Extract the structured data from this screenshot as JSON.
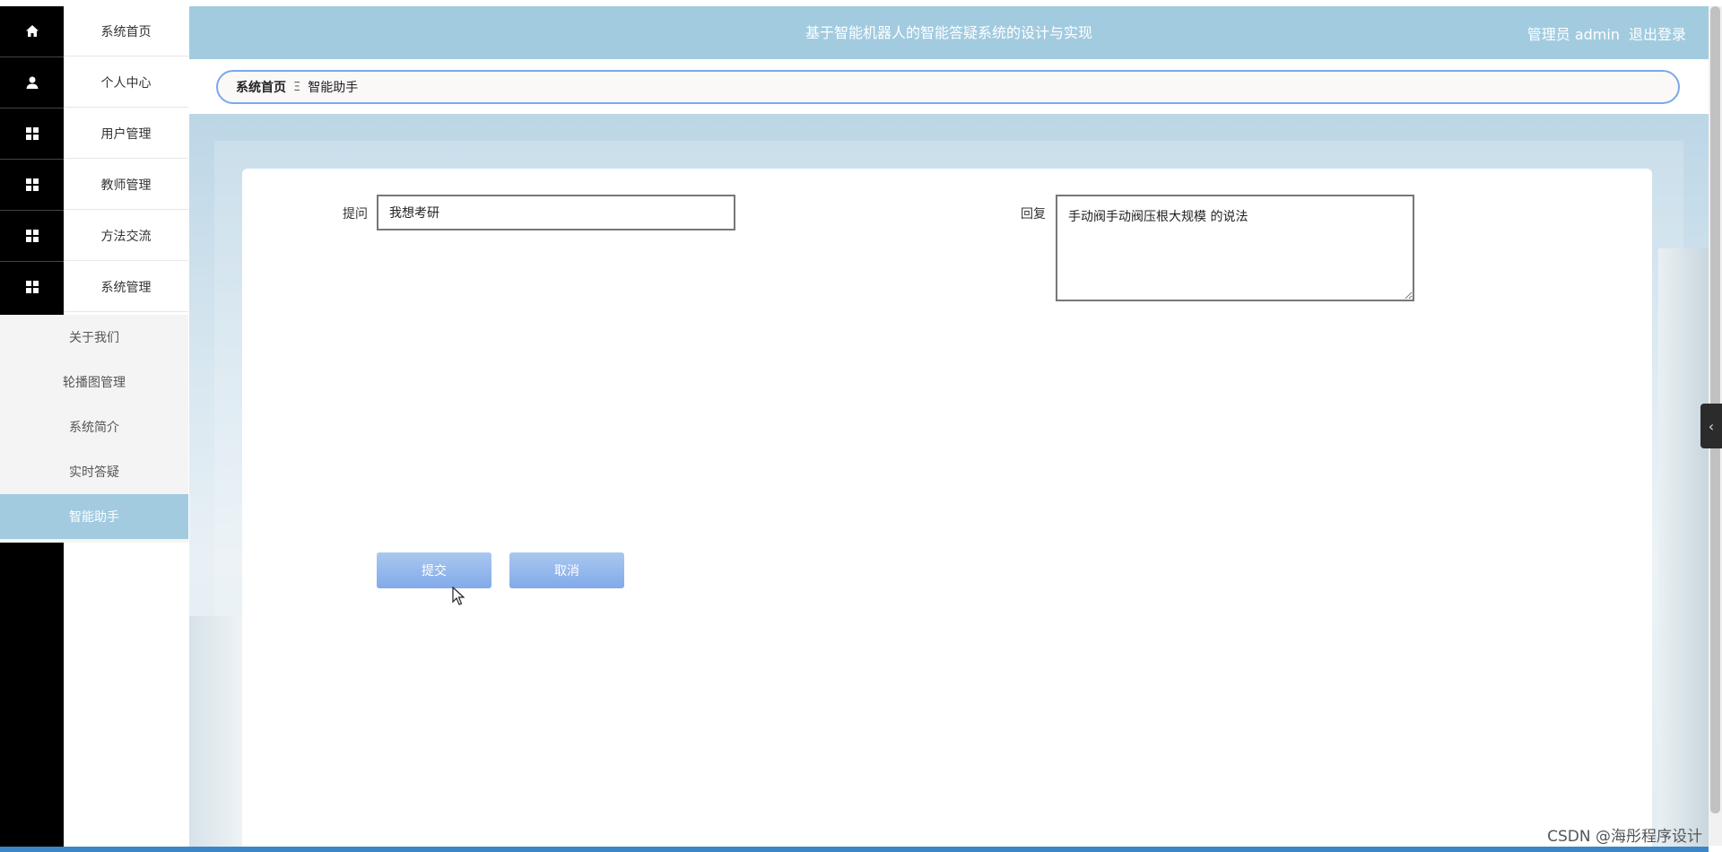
{
  "header": {
    "title": "基于智能机器人的智能答疑系统的设计与实现",
    "user_label": "管理员 admin",
    "logout_label": "退出登录"
  },
  "sidebar": {
    "items": [
      {
        "label": "系统首页",
        "icon": "home-icon"
      },
      {
        "label": "个人中心",
        "icon": "user-icon"
      },
      {
        "label": "用户管理",
        "icon": "grid-icon"
      },
      {
        "label": "教师管理",
        "icon": "grid-icon"
      },
      {
        "label": "方法交流",
        "icon": "grid-icon"
      },
      {
        "label": "系统管理",
        "icon": "grid-icon"
      }
    ],
    "submenu": [
      {
        "label": "关于我们"
      },
      {
        "label": "轮播图管理"
      },
      {
        "label": "系统简介"
      },
      {
        "label": "实时答疑"
      },
      {
        "label": "智能助手",
        "active": true
      }
    ]
  },
  "breadcrumb": {
    "home": "系统首页",
    "separator": "Ξ",
    "current": "智能助手"
  },
  "form": {
    "question_label": "提问",
    "question_value": "我想考研",
    "reply_label": "回复",
    "reply_value": "手动阀手动阀压根大规模 的说法",
    "submit_label": "提交",
    "cancel_label": "取消"
  },
  "watermark": "CSDN @海彤程序设计",
  "colors": {
    "accent": "#a2cbe0",
    "button": "#82aaea",
    "rail": "#000000",
    "breadcrumb_border": "#7aa8ee"
  }
}
